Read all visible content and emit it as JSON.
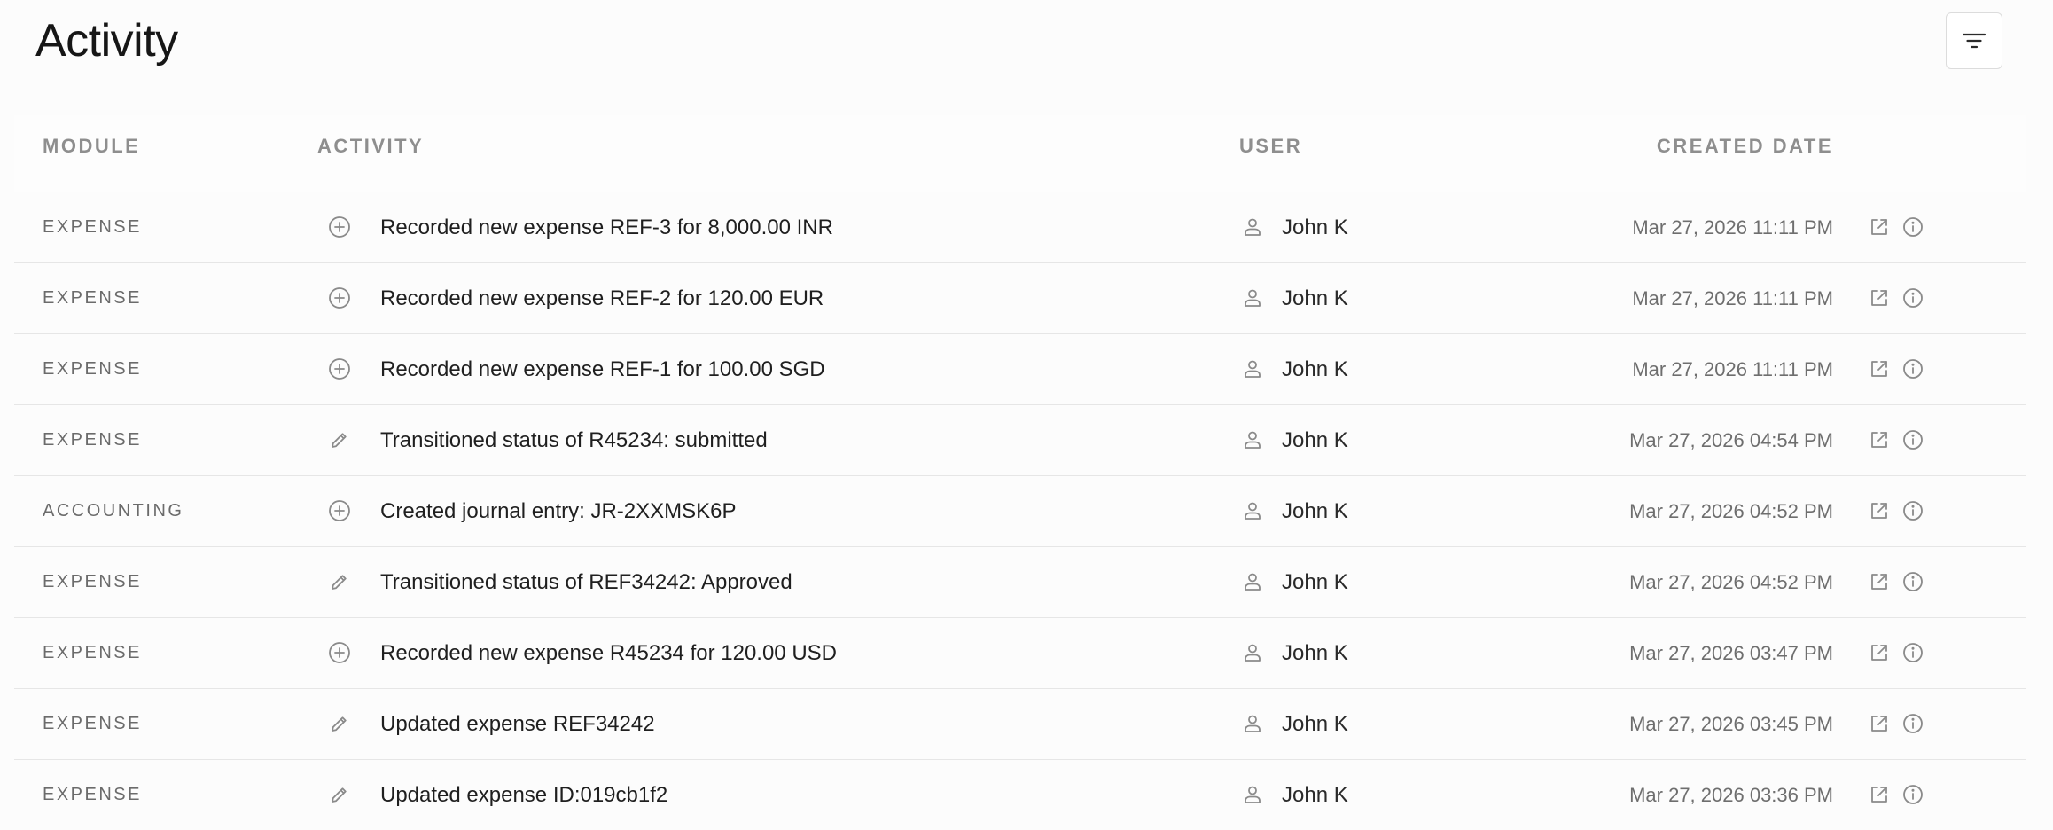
{
  "page": {
    "title": "Activity"
  },
  "toolbar": {
    "filter_icon": "filter-lines-icon"
  },
  "table": {
    "columns": {
      "module": "MODULE",
      "activity": "ACTIVITY",
      "user": "USER",
      "created_date": "CREATED DATE"
    },
    "rows": [
      {
        "module": "EXPENSE",
        "icon": "plus-circle-icon",
        "activity": "Recorded new expense REF-3 for 8,000.00 INR",
        "user": "John K",
        "created_date": "Mar 27, 2026 11:11 PM"
      },
      {
        "module": "EXPENSE",
        "icon": "plus-circle-icon",
        "activity": "Recorded new expense REF-2 for 120.00 EUR",
        "user": "John K",
        "created_date": "Mar 27, 2026 11:11 PM"
      },
      {
        "module": "EXPENSE",
        "icon": "plus-circle-icon",
        "activity": "Recorded new expense REF-1 for 100.00 SGD",
        "user": "John K",
        "created_date": "Mar 27, 2026 11:11 PM"
      },
      {
        "module": "EXPENSE",
        "icon": "pencil-icon",
        "activity": "Transitioned status of R45234: submitted",
        "user": "John K",
        "created_date": "Mar 27, 2026 04:54 PM"
      },
      {
        "module": "ACCOUNTING",
        "icon": "plus-circle-icon",
        "activity": "Created journal entry: JR-2XXMSK6P",
        "user": "John K",
        "created_date": "Mar 27, 2026 04:52 PM"
      },
      {
        "module": "EXPENSE",
        "icon": "pencil-icon",
        "activity": "Transitioned status of REF34242: Approved",
        "user": "John K",
        "created_date": "Mar 27, 2026 04:52 PM"
      },
      {
        "module": "EXPENSE",
        "icon": "plus-circle-icon",
        "activity": "Recorded new expense R45234 for 120.00 USD",
        "user": "John K",
        "created_date": "Mar 27, 2026 03:47 PM"
      },
      {
        "module": "EXPENSE",
        "icon": "pencil-icon",
        "activity": "Updated expense REF34242",
        "user": "John K",
        "created_date": "Mar 27, 2026 03:45 PM"
      },
      {
        "module": "EXPENSE",
        "icon": "pencil-icon",
        "activity": "Updated expense ID:019cb1f2",
        "user": "John K",
        "created_date": "Mar 27, 2026 03:36 PM"
      }
    ],
    "row_actions": {
      "open_icon": "external-link-icon",
      "info_icon": "info-circle-icon"
    }
  },
  "colors": {
    "background": "#fcfcfc",
    "header_text": "#8e8e8e",
    "icon": "#8a8a8a",
    "border": "#e6e6e6"
  }
}
